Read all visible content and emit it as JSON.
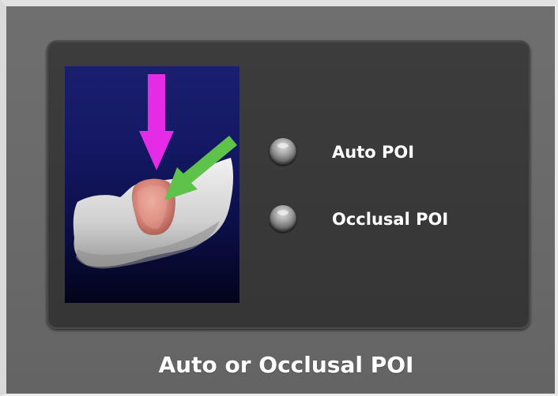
{
  "panel": {
    "title": "Auto or Occlusal POI"
  },
  "preview": {
    "icon": "tooth-poi-illustration",
    "arrows": [
      {
        "name": "vertical-arrow",
        "color": "#e62be6"
      },
      {
        "name": "diagonal-arrow",
        "color": "#5fc24a"
      }
    ]
  },
  "options": [
    {
      "label": "Auto POI",
      "icon": "radio-button"
    },
    {
      "label": "Occlusal POI",
      "icon": "radio-button"
    }
  ]
}
